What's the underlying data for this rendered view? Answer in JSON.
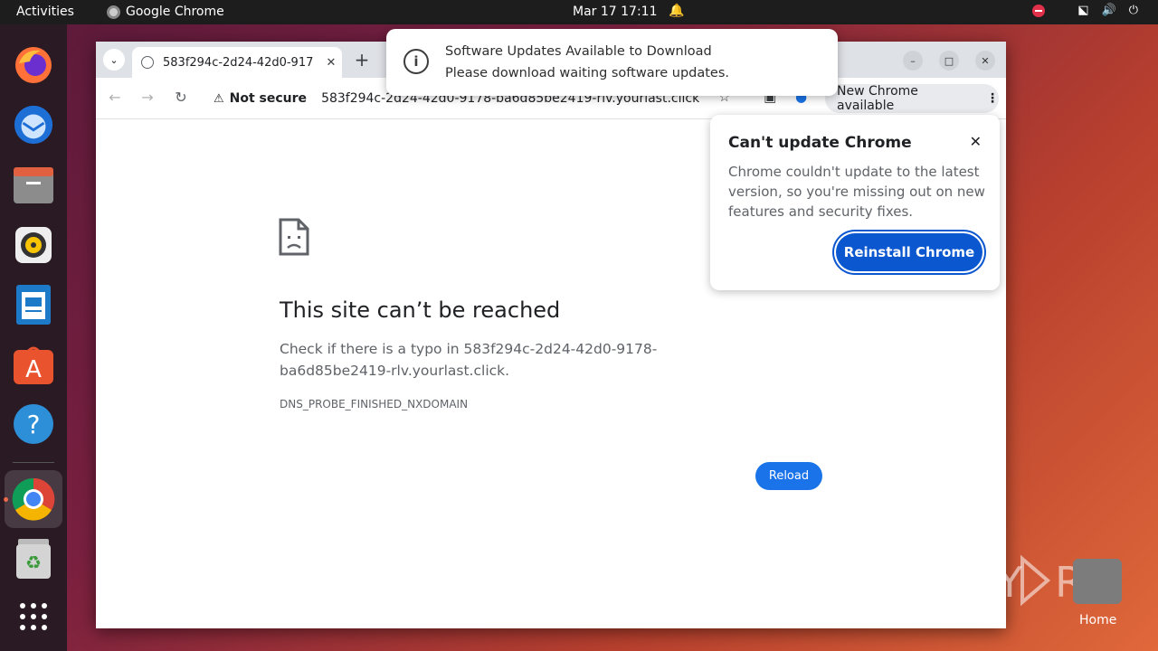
{
  "topbar": {
    "activities": "Activities",
    "app_name": "Google Chrome",
    "clock": "Mar 17  17:11"
  },
  "dock": {
    "items": [
      "firefox",
      "thunderbird",
      "files",
      "rhythmbox",
      "libreoffice-writer",
      "app-center",
      "help",
      "google-chrome",
      "trash",
      "show-apps"
    ]
  },
  "browser": {
    "tab_title": "583f294c-2d24-42d0-917",
    "not_secure": "Not secure",
    "url": "583f294c-2d24-42d0-9178-ba6d85be2419-rlv.yourlast.click",
    "new_chrome": "New Chrome available"
  },
  "page": {
    "title": "This site can’t be reached",
    "message": "Check if there is a typo in 583f294c-2d24-42d0-9178-ba6d85be2419-rlv.yourlast.click.",
    "error_code": "DNS_PROBE_FINISHED_NXDOMAIN",
    "reload": "Reload"
  },
  "update_popup": {
    "title": "Can't update Chrome",
    "body": "Chrome couldn't update to the latest version, so you're missing out on new features and security fixes.",
    "button": "Reinstall Chrome"
  },
  "notification": {
    "title": "Software Updates Available to Download",
    "body": "Please download waiting software updates."
  },
  "desktop": {
    "home_label": "Home",
    "watermark": "ANY RUN"
  },
  "colors": {
    "accent_blue": "#1a73e8",
    "reinstall_blue": "#0b57d0",
    "topbar": "#1d1d1d"
  }
}
